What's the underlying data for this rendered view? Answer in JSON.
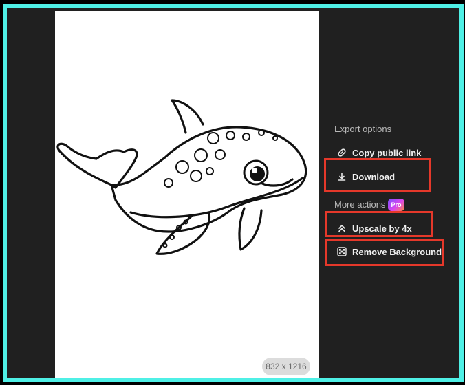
{
  "image": {
    "dimensions_label": "832 x 1216"
  },
  "export_panel": {
    "export_heading": "Export options",
    "copy_link_label": "Copy public link",
    "download_label": "Download",
    "more_heading": "More actions",
    "pro_badge": "Pro",
    "upscale_label": "Upscale by 4x",
    "remove_bg_label": "Remove Background"
  },
  "icons": {
    "copy_link": "link-icon",
    "download": "download-icon",
    "upscale": "double-chevron-up-icon",
    "remove_bg": "checkerboard-icon"
  },
  "colors": {
    "frame_border": "#4ff0e6",
    "panel_bg": "#202020",
    "highlight": "#e5382a"
  }
}
